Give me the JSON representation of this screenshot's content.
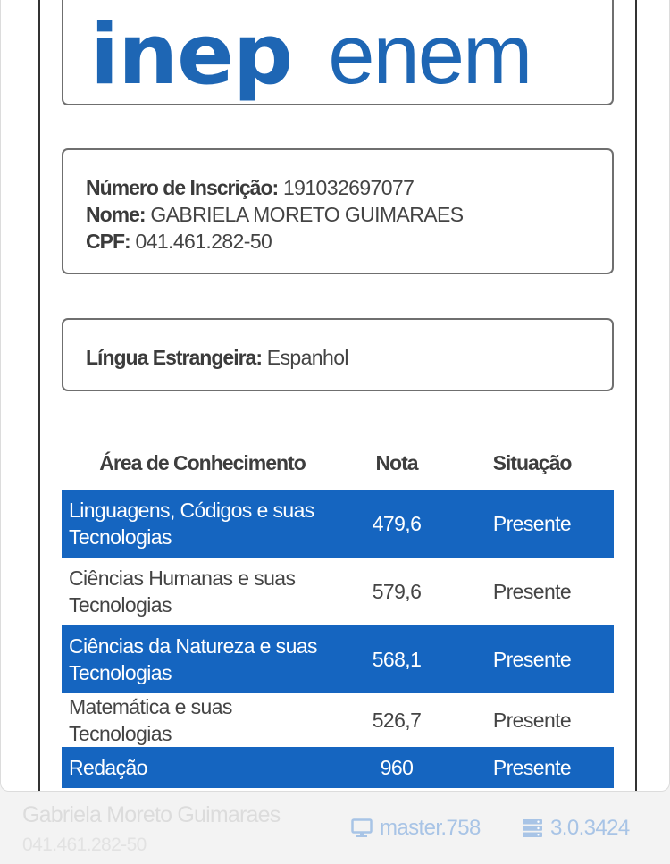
{
  "logo": {
    "left": "inep",
    "right": "enem"
  },
  "candidate": {
    "inscricao_label": "Número de Inscrição:",
    "inscricao_value": "191032697077",
    "nome_label": "Nome:",
    "nome_value": "GABRIELA MORETO GUIMARAES",
    "cpf_label": "CPF:",
    "cpf_value": "041.461.282-50"
  },
  "language": {
    "label": "Língua Estrangeira:",
    "value": "Espanhol"
  },
  "table": {
    "headers": [
      "Área de Conhecimento",
      "Nota",
      "Situação"
    ],
    "rows": [
      {
        "area": "Linguagens, Códigos e suas Tecnologias",
        "nota": "479,6",
        "situacao": "Presente"
      },
      {
        "area": "Ciências Humanas e suas Tecnologias",
        "nota": "579,6",
        "situacao": "Presente"
      },
      {
        "area": "Ciências da Natureza e suas Tecnologias",
        "nota": "568,1",
        "situacao": "Presente"
      },
      {
        "area": "Matemática e suas Tecnologias",
        "nota": "526,7",
        "situacao": "Presente"
      },
      {
        "area": "Redação",
        "nota": "960",
        "situacao": "Presente"
      }
    ]
  },
  "footer": {
    "user_name": "Gabriela Moreto Guimaraes",
    "user_cpf": "041.461.282-50",
    "branch": "master.758",
    "version": "3.0.3424",
    "branch_icon": "monitor-icon",
    "version_icon": "server-icon"
  },
  "colors": {
    "brand_blue": "#1e66b4",
    "row_highlight": "#1565c0",
    "footer_text": "#a8c4e6"
  }
}
